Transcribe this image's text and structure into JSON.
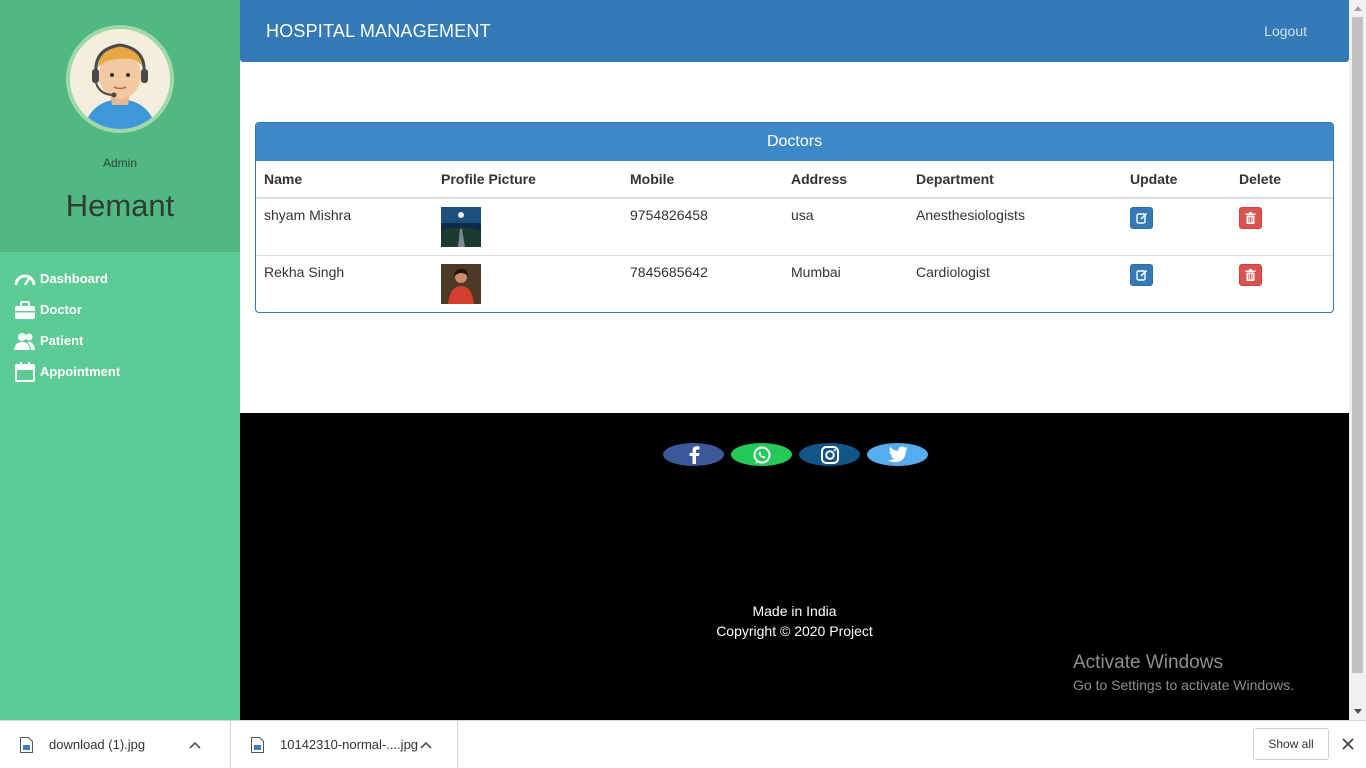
{
  "sidebar": {
    "role": "Admin",
    "username": "Hemant",
    "nav": [
      {
        "label": "Dashboard",
        "icon": "dashboard-icon"
      },
      {
        "label": "Doctor",
        "icon": "briefcase-icon"
      },
      {
        "label": "Patient",
        "icon": "users-icon"
      },
      {
        "label": "Appointment",
        "icon": "calendar-icon"
      }
    ]
  },
  "header": {
    "title": "HOSPITAL MANAGEMENT",
    "logout": "Logout"
  },
  "panel": {
    "title": "Doctors",
    "columns": [
      "Name",
      "Profile Picture",
      "Mobile",
      "Address",
      "Department",
      "Update",
      "Delete"
    ],
    "rows": [
      {
        "name": "shyam Mishra",
        "picture": "landscape-photo",
        "mobile": "9754826458",
        "address": "usa",
        "department": "Anesthesiologists"
      },
      {
        "name": "Rekha Singh",
        "picture": "woman-photo",
        "mobile": "7845685642",
        "address": "Mumbai",
        "department": "Cardiologist"
      }
    ]
  },
  "footer": {
    "social": [
      "facebook",
      "whatsapp",
      "instagram",
      "twitter"
    ],
    "made": "Made in India",
    "copyright": "Copyright © 2020 Project"
  },
  "watermark": {
    "line1": "Activate Windows",
    "line2": "Go to Settings to activate Windows."
  },
  "downloads": {
    "items": [
      "download (1).jpg",
      "10142310-normal-....jpg"
    ],
    "show_all": "Show all"
  },
  "colors": {
    "sidebar": "#5dcb95",
    "header": "#337ab7",
    "update_button": "#337ab7",
    "delete_button": "#d9534f"
  }
}
